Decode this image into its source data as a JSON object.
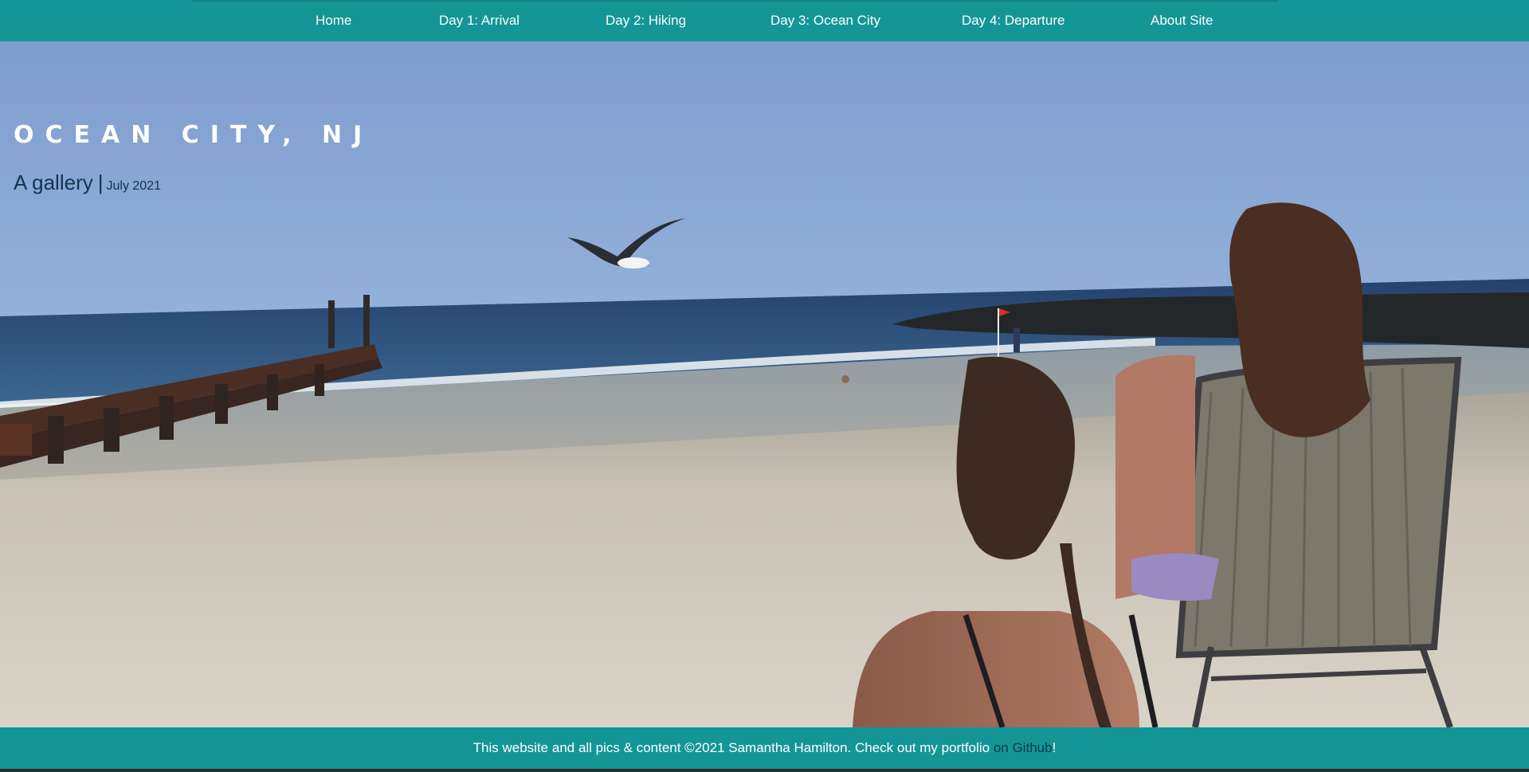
{
  "nav": {
    "items": [
      {
        "label": "Home"
      },
      {
        "label": "Day 1: Arrival"
      },
      {
        "label": "Day 2: Hiking"
      },
      {
        "label": "Day 3: Ocean City"
      },
      {
        "label": "Day 4: Departure"
      },
      {
        "label": "About Site"
      }
    ]
  },
  "hero": {
    "title": "OCEAN CITY, NJ",
    "subtitle": "A gallery",
    "separator": "|",
    "date": "July 2021"
  },
  "footer": {
    "text": "This website and all pics & content ©2021 Samantha Hamilton. Check out my portfolio",
    "link_text": "on Github",
    "suffix": "!"
  },
  "colors": {
    "nav_background": "#149696",
    "subtitle_text": "#0f3550",
    "link_text": "#0f3550"
  }
}
